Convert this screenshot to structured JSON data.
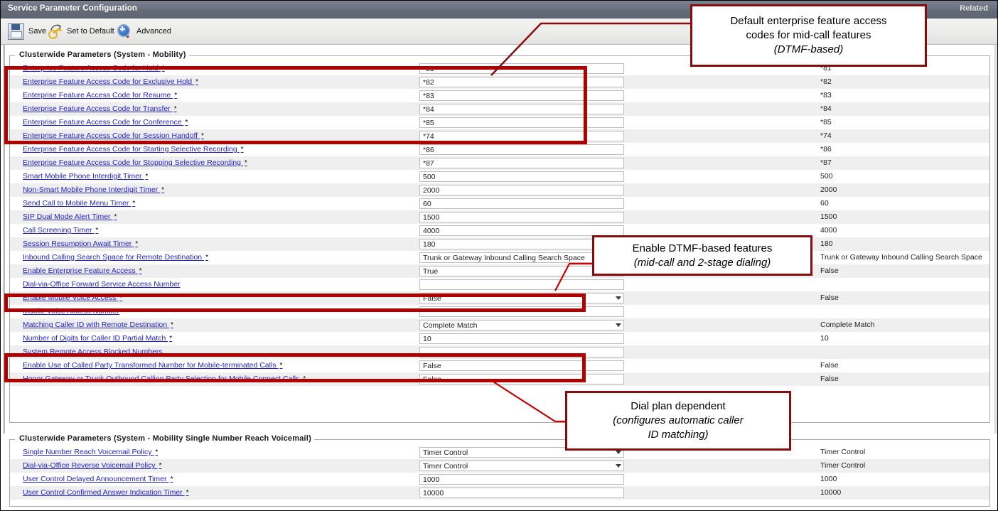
{
  "window": {
    "title": "Service Parameter Configuration",
    "related_label": "Related"
  },
  "toolbar": {
    "save_label": "Save",
    "set_to_default_label": "Set to Default",
    "advanced_label": "Advanced"
  },
  "groups": [
    {
      "legend": "Clusterwide Parameters (System - Mobility)"
    },
    {
      "legend": "Clusterwide Parameters (System - Mobility Single Number Reach Voicemail)"
    }
  ],
  "mobility_rows": [
    {
      "label": "Enterprise Feature Access Code for Hold",
      "required": true,
      "type": "text",
      "value": "*81",
      "default": "*81"
    },
    {
      "label": "Enterprise Feature Access Code for Exclusive Hold",
      "required": true,
      "type": "text",
      "value": "*82",
      "default": "*82"
    },
    {
      "label": "Enterprise Feature Access Code for Resume",
      "required": true,
      "type": "text",
      "value": "*83",
      "default": "*83"
    },
    {
      "label": "Enterprise Feature Access Code for Transfer",
      "required": true,
      "type": "text",
      "value": "*84",
      "default": "*84"
    },
    {
      "label": "Enterprise Feature Access Code for Conference",
      "required": true,
      "type": "text",
      "value": "*85",
      "default": "*85"
    },
    {
      "label": "Enterprise Feature Access Code for Session Handoff",
      "required": true,
      "type": "text",
      "value": "*74",
      "default": "*74"
    },
    {
      "label": "Enterprise Feature Access Code for Starting Selective Recording",
      "required": true,
      "type": "text",
      "value": "*86",
      "default": "*86"
    },
    {
      "label": "Enterprise Feature Access Code for Stopping Selective Recording",
      "required": true,
      "type": "text",
      "value": "*87",
      "default": "*87"
    },
    {
      "label": "Smart Mobile Phone Interdigit Timer",
      "required": true,
      "type": "text",
      "value": "500",
      "default": "500"
    },
    {
      "label": "Non-Smart Mobile Phone Interdigit Timer",
      "required": true,
      "type": "text",
      "value": "2000",
      "default": "2000"
    },
    {
      "label": "Send Call to Mobile Menu Timer",
      "required": true,
      "type": "text",
      "value": "60",
      "default": "60"
    },
    {
      "label": "SIP Dual Mode Alert Timer",
      "required": true,
      "type": "text",
      "value": "1500",
      "default": "1500"
    },
    {
      "label": "Call Screening Timer",
      "required": true,
      "type": "text",
      "value": "4000",
      "default": "4000"
    },
    {
      "label": "Session Resumption Await Timer",
      "required": true,
      "type": "text",
      "value": "180",
      "default": "180"
    },
    {
      "label": "Inbound Calling Search Space for Remote Destination",
      "required": true,
      "type": "select",
      "value": "Trunk or Gateway Inbound Calling Search Space",
      "default": "Trunk or Gateway Inbound Calling Search Space"
    },
    {
      "label": "Enable Enterprise Feature Access",
      "required": true,
      "type": "select",
      "value": "True",
      "default": "False"
    },
    {
      "label": "Dial-via-Office Forward Service Access Number",
      "required": false,
      "type": "text",
      "value": "",
      "default": ""
    },
    {
      "label": "Enable Mobile Voice Access",
      "required": true,
      "type": "select",
      "value": "False",
      "default": "False"
    },
    {
      "label": "Mobile Voice Access Number",
      "required": false,
      "type": "text",
      "value": "",
      "default": ""
    },
    {
      "label": "Matching Caller ID with Remote Destination",
      "required": true,
      "type": "select",
      "value": "Complete Match",
      "default": "Complete Match"
    },
    {
      "label": "Number of Digits for Caller ID Partial Match",
      "required": true,
      "type": "text",
      "value": "10",
      "default": "10"
    },
    {
      "label": "System Remote Access Blocked Numbers",
      "required": false,
      "type": "text",
      "value": "",
      "default": ""
    },
    {
      "label": "Enable Use of Called Party Transformed Number for Mobile-terminated Calls",
      "required": true,
      "type": "text",
      "value": "False",
      "default": "False"
    },
    {
      "label": "Honor Gateway or Trunk Outbound Calling Party Selection for Mobile Connect Calls",
      "required": true,
      "type": "text",
      "value": "False",
      "default": "False"
    }
  ],
  "voicemail_rows": [
    {
      "label": "Single Number Reach Voicemail Policy",
      "required": true,
      "type": "select",
      "value": "Timer Control",
      "default": "Timer Control"
    },
    {
      "label": "Dial-via-Office Reverse Voicemail Policy",
      "required": true,
      "type": "select",
      "value": "Timer Control",
      "default": "Timer Control"
    },
    {
      "label": "User Control Delayed Announcement Timer",
      "required": true,
      "type": "text",
      "value": "1000",
      "default": "1000"
    },
    {
      "label": "User Control Confirmed Answer Indication Timer",
      "required": true,
      "type": "text",
      "value": "10000",
      "default": "10000"
    }
  ],
  "callouts": [
    {
      "line1": "Default enterprise feature access",
      "line2": "codes for mid-call features",
      "line3": "(DTMF-based)"
    },
    {
      "line1": "Enable DTMF-based features",
      "line2": "(mid-call and 2-stage dialing)",
      "line3": ""
    },
    {
      "line1": "Dial plan dependent",
      "line2": "(configures  automatic caller",
      "line3": "ID matching)"
    }
  ],
  "colors": {
    "highlight": "#b00000",
    "callout_border": "#8a0b0b",
    "titlebar": "#6b7280",
    "link": "#2222cc"
  }
}
